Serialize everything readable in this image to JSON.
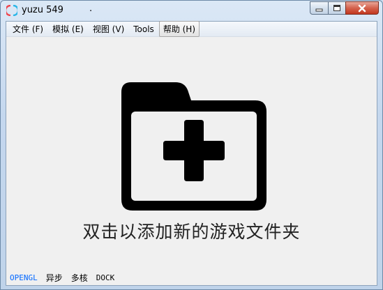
{
  "window": {
    "title": "yuzu 549",
    "title_extra": ".",
    "controls": {
      "minimize_icon": "minimize-icon",
      "maximize_icon": "maximize-icon",
      "close_icon": "close-icon"
    }
  },
  "menubar": {
    "items": [
      {
        "label": "文件 (F)"
      },
      {
        "label": "模拟 (E)"
      },
      {
        "label": "视图 (V)"
      },
      {
        "label": "Tools"
      },
      {
        "label": "帮助 (H)"
      }
    ]
  },
  "main": {
    "icon": "folder-add-icon",
    "hint": "双击以添加新的游戏文件夹"
  },
  "statusbar": {
    "renderer": "OPENGL",
    "async": "异步",
    "multicore": "多核",
    "dock": "DOCK"
  },
  "colors": {
    "renderer_accent": "#0066ff",
    "close_button": "#c8452e",
    "client_background": "#f0f0f0"
  }
}
